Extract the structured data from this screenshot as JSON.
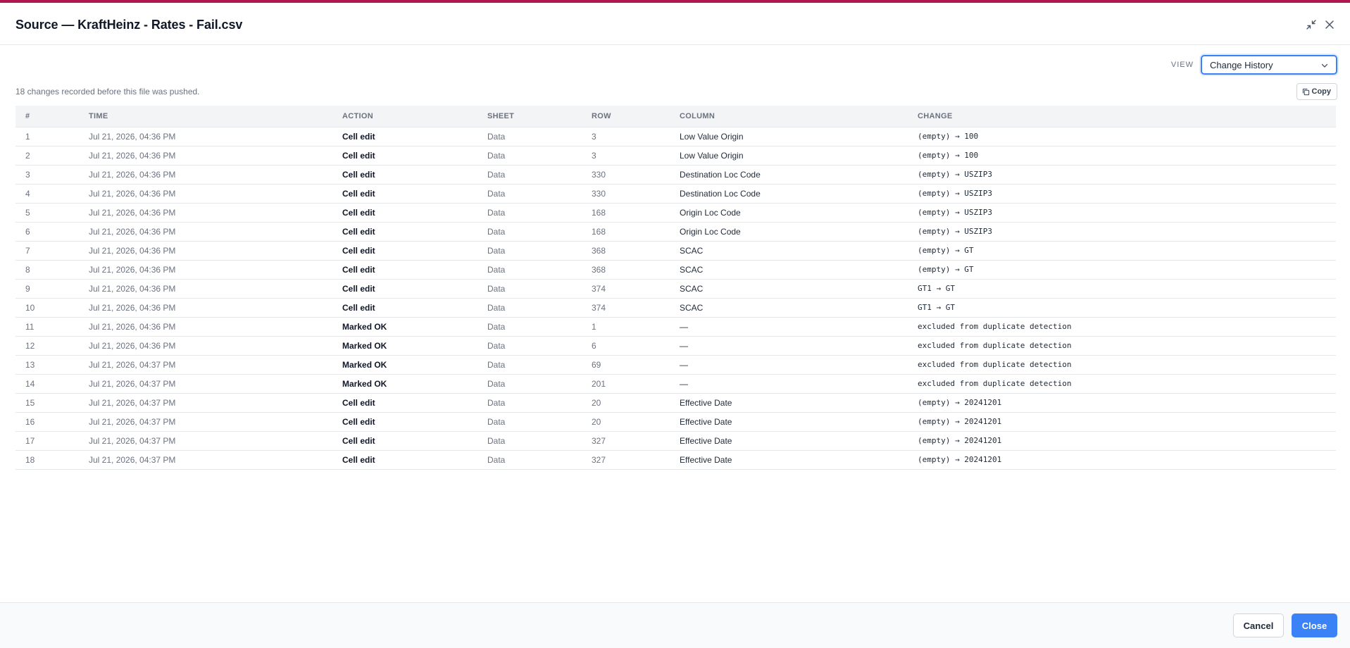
{
  "header": {
    "title": "Source — KraftHeinz - Rates - Fail.csv"
  },
  "view": {
    "label": "VIEW",
    "selected": "Change History"
  },
  "summary": "18 changes recorded before this file was pushed.",
  "copy_label": "Copy",
  "columns": [
    "#",
    "TIME",
    "ACTION",
    "SHEET",
    "ROW",
    "COLUMN",
    "CHANGE"
  ],
  "rows": [
    {
      "num": "1",
      "time": "Jul 21, 2026, 04:36 PM",
      "action": "Cell edit",
      "sheet": "Data",
      "row": "3",
      "column": "Low Value Origin",
      "change": "(empty) → 100"
    },
    {
      "num": "2",
      "time": "Jul 21, 2026, 04:36 PM",
      "action": "Cell edit",
      "sheet": "Data",
      "row": "3",
      "column": "Low Value Origin",
      "change": "(empty) → 100"
    },
    {
      "num": "3",
      "time": "Jul 21, 2026, 04:36 PM",
      "action": "Cell edit",
      "sheet": "Data",
      "row": "330",
      "column": "Destination Loc Code",
      "change": "(empty) → USZIP3"
    },
    {
      "num": "4",
      "time": "Jul 21, 2026, 04:36 PM",
      "action": "Cell edit",
      "sheet": "Data",
      "row": "330",
      "column": "Destination Loc Code",
      "change": "(empty) → USZIP3"
    },
    {
      "num": "5",
      "time": "Jul 21, 2026, 04:36 PM",
      "action": "Cell edit",
      "sheet": "Data",
      "row": "168",
      "column": "Origin Loc Code",
      "change": "(empty) → USZIP3"
    },
    {
      "num": "6",
      "time": "Jul 21, 2026, 04:36 PM",
      "action": "Cell edit",
      "sheet": "Data",
      "row": "168",
      "column": "Origin Loc Code",
      "change": "(empty) → USZIP3"
    },
    {
      "num": "7",
      "time": "Jul 21, 2026, 04:36 PM",
      "action": "Cell edit",
      "sheet": "Data",
      "row": "368",
      "column": "SCAC",
      "change": "(empty) → GT"
    },
    {
      "num": "8",
      "time": "Jul 21, 2026, 04:36 PM",
      "action": "Cell edit",
      "sheet": "Data",
      "row": "368",
      "column": "SCAC",
      "change": "(empty) → GT"
    },
    {
      "num": "9",
      "time": "Jul 21, 2026, 04:36 PM",
      "action": "Cell edit",
      "sheet": "Data",
      "row": "374",
      "column": "SCAC",
      "change": "GT1 → GT"
    },
    {
      "num": "10",
      "time": "Jul 21, 2026, 04:36 PM",
      "action": "Cell edit",
      "sheet": "Data",
      "row": "374",
      "column": "SCAC",
      "change": "GT1 → GT"
    },
    {
      "num": "11",
      "time": "Jul 21, 2026, 04:36 PM",
      "action": "Marked OK",
      "sheet": "Data",
      "row": "1",
      "column": "—",
      "change": "excluded from duplicate detection"
    },
    {
      "num": "12",
      "time": "Jul 21, 2026, 04:36 PM",
      "action": "Marked OK",
      "sheet": "Data",
      "row": "6",
      "column": "—",
      "change": "excluded from duplicate detection"
    },
    {
      "num": "13",
      "time": "Jul 21, 2026, 04:37 PM",
      "action": "Marked OK",
      "sheet": "Data",
      "row": "69",
      "column": "—",
      "change": "excluded from duplicate detection"
    },
    {
      "num": "14",
      "time": "Jul 21, 2026, 04:37 PM",
      "action": "Marked OK",
      "sheet": "Data",
      "row": "201",
      "column": "—",
      "change": "excluded from duplicate detection"
    },
    {
      "num": "15",
      "time": "Jul 21, 2026, 04:37 PM",
      "action": "Cell edit",
      "sheet": "Data",
      "row": "20",
      "column": "Effective Date",
      "change": "(empty) → 20241201"
    },
    {
      "num": "16",
      "time": "Jul 21, 2026, 04:37 PM",
      "action": "Cell edit",
      "sheet": "Data",
      "row": "20",
      "column": "Effective Date",
      "change": "(empty) → 20241201"
    },
    {
      "num": "17",
      "time": "Jul 21, 2026, 04:37 PM",
      "action": "Cell edit",
      "sheet": "Data",
      "row": "327",
      "column": "Effective Date",
      "change": "(empty) → 20241201"
    },
    {
      "num": "18",
      "time": "Jul 21, 2026, 04:37 PM",
      "action": "Cell edit",
      "sheet": "Data",
      "row": "327",
      "column": "Effective Date",
      "change": "(empty) → 20241201"
    }
  ],
  "footer": {
    "cancel_label": "Cancel",
    "close_label": "Close"
  },
  "icons": {
    "minimize": "minimize-icon",
    "close": "close-icon",
    "chevron": "chevron-down-icon",
    "copy": "copy-icon"
  },
  "colors": {
    "accent_top": "#b0164f",
    "primary": "#3b82f6"
  }
}
